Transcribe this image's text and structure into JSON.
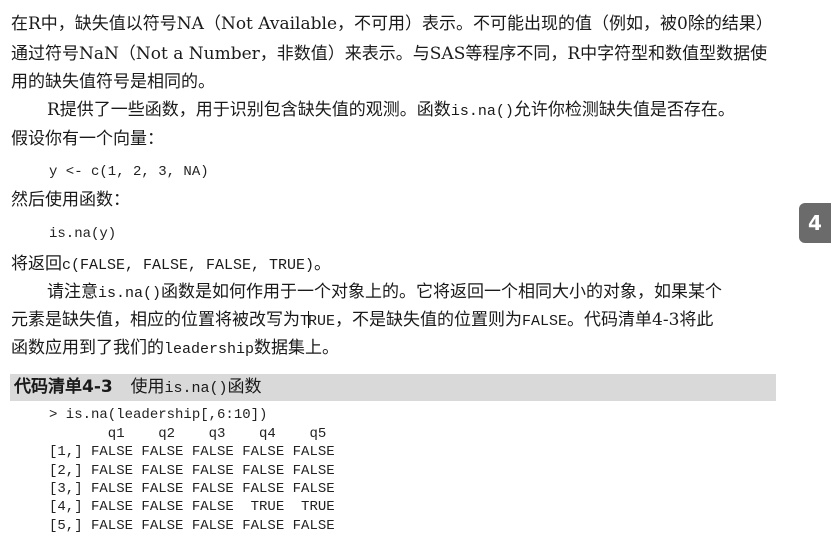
{
  "para1": {
    "line1": "在R中，缺失值以符号NA（Not Available，不可用）表示。不可能出现的值（例如，被0除的结果）",
    "line2": "通过符号NaN（Not a Number，非数值）来表示。与SAS等程序不同，R中字符型和数值型数据使",
    "line3": "用的缺失值符号是相同的。"
  },
  "para2": {
    "line1_a": "R提供了一些函数，用于识别包含缺失值的观测。函数",
    "line1_code": "is.na()",
    "line1_b": "允许你检测缺失值是否存在。",
    "line2": "假设你有一个向量："
  },
  "code1": "y <- c(1, 2, 3, NA)",
  "text_then": "然后使用函数：",
  "code2": "is.na(y)",
  "returns": {
    "a": "将返回",
    "code": "c(FALSE, FALSE, FALSE, TRUE)",
    "b": "。"
  },
  "para3": {
    "line1_a": "请注意",
    "line1_code": "is.na()",
    "line1_b": "函数是如何作用于一个对象上的。它将返回一个相同大小的对象，如果某个",
    "line2_a": "元素是缺失值，相应的位置将被改写为",
    "line2_code_a": "T",
    "line2_code_b": "RUE",
    "line2_b": "，不是缺失值的位置则为",
    "line2_code2": "FALSE",
    "line2_c": "。代码清单4-3将此",
    "line3_a": "函数应用到了我们的",
    "line3_code": "leadership",
    "line3_b": "数据集上。"
  },
  "listing": {
    "label": "代码清单4-3",
    "title_a": "使用",
    "title_code": "is.na()",
    "title_b": "函数"
  },
  "output": {
    "command": "> is.na(leadership[,6:10])",
    "header": "       q1    q2    q3    q4    q5",
    "rows": [
      "[1,] FALSE FALSE FALSE FALSE FALSE",
      "[2,] FALSE FALSE FALSE FALSE FALSE",
      "[3,] FALSE FALSE FALSE FALSE FALSE",
      "[4,] FALSE FALSE FALSE  TRUE  TRUE",
      "[5,] FALSE FALSE FALSE FALSE FALSE"
    ]
  },
  "chapter_tab": "4"
}
